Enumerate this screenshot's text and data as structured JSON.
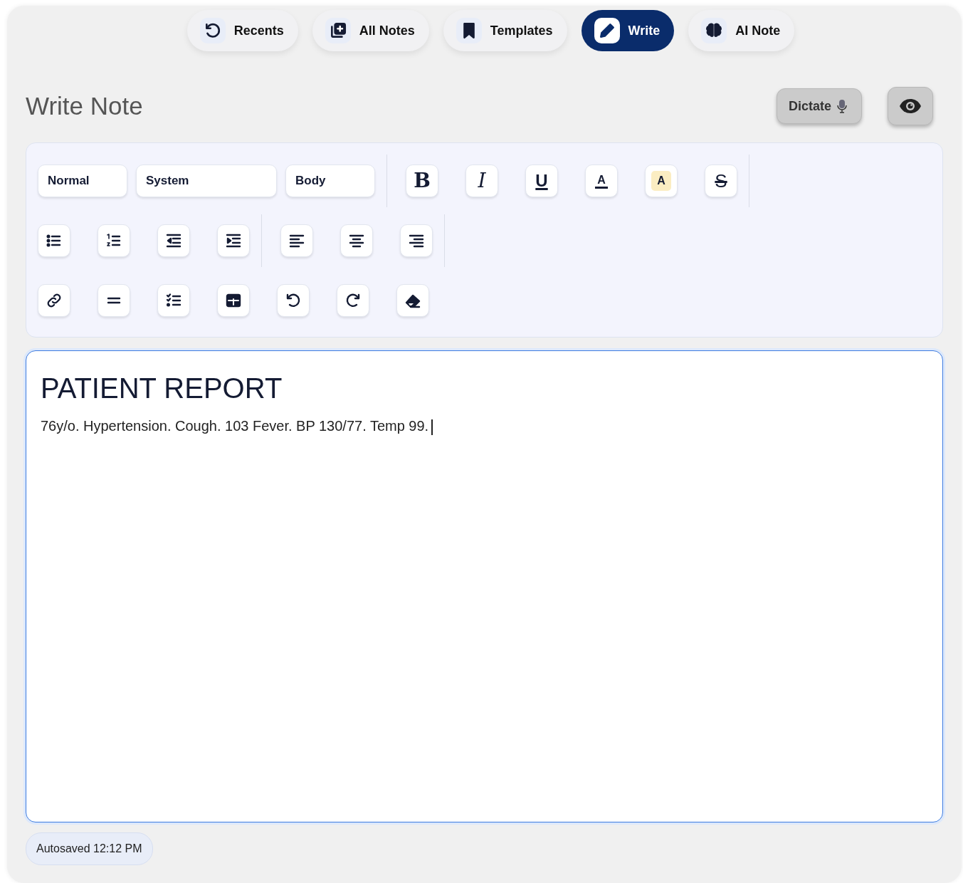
{
  "tabs": [
    {
      "label": "Recents",
      "selected": false
    },
    {
      "label": "All Notes",
      "selected": false
    },
    {
      "label": "Templates",
      "selected": false
    },
    {
      "label": "Write",
      "selected": true
    },
    {
      "label": "AI Note",
      "selected": false
    }
  ],
  "page_title": "Write Note",
  "dictate_button": {
    "label": "Dictate"
  },
  "toolbar": {
    "rows": [
      {
        "groups": [
          [
            {
              "kind": "select",
              "label": "Normal"
            },
            {
              "kind": "select",
              "label": "System"
            },
            {
              "kind": "select",
              "label": "Body"
            }
          ],
          [
            {
              "kind": "bold",
              "label": "B"
            },
            {
              "kind": "italic",
              "label": "I"
            },
            {
              "kind": "underline",
              "label": "U"
            },
            {
              "kind": "color",
              "label": "A"
            },
            {
              "kind": "highlight",
              "label": "A"
            },
            {
              "kind": "strike",
              "label": "S"
            }
          ]
        ]
      },
      {
        "groups": [
          [
            {
              "kind": "bullets"
            },
            {
              "kind": "numbers"
            },
            {
              "kind": "outdent"
            },
            {
              "kind": "indent"
            }
          ],
          [
            {
              "kind": "align-left"
            },
            {
              "kind": "align-center"
            },
            {
              "kind": "align-right"
            }
          ]
        ]
      },
      {
        "groups": [
          [
            {
              "kind": "link"
            },
            {
              "kind": "rule"
            },
            {
              "kind": "checklist"
            },
            {
              "kind": "table"
            },
            {
              "kind": "undo"
            },
            {
              "kind": "redo"
            },
            {
              "kind": "eraser"
            }
          ]
        ]
      }
    ]
  },
  "editor": {
    "heading": "PATIENT REPORT",
    "body": "76y/o. Hypertension. Cough. 103 Fever. BP 130/77. Temp 99."
  },
  "status": "Autosaved 12:12 PM"
}
